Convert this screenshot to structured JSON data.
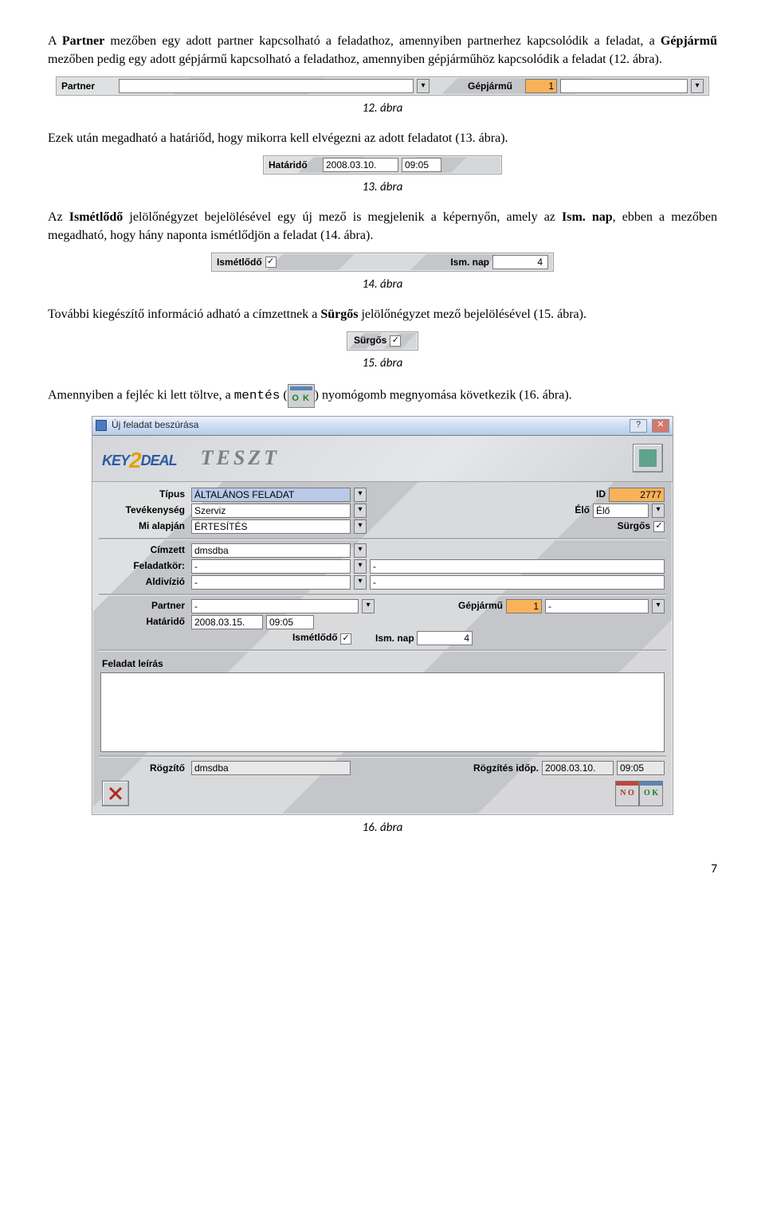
{
  "para1_pre": "A ",
  "para1_b1": "Partner",
  "para1_mid1": " mezőben egy adott partner kapcsolható a feladathoz, amennyiben partnerhez kapcsolódik a feladat, a ",
  "para1_b2": "Gépjármű",
  "para1_mid2": " mezőben pedig egy adott gépjármű kapcsolható a feladathoz, amennyiben gépjárműhöz kapcsolódik a feladat (12. ábra).",
  "fig12": {
    "partner_label": "Partner",
    "partner_value": "",
    "gepjarmu_label": "Gépjármű",
    "gepjarmu_code": "1",
    "gepjarmu_text": ""
  },
  "cap12": "12. ábra",
  "para2": "Ezek után megadható a határiőd, hogy mikorra kell elvégezni az adott feladatot (13. ábra).",
  "fig13": {
    "label": "Határidő",
    "date": "2008.03.10.",
    "time": "09:05"
  },
  "cap13": "13. ábra",
  "para3_pre": "Az ",
  "para3_b1": "Ismétlődő",
  "para3_mid": " jelölőnégyzet bejelölésével egy új mező is megjelenik a képernyőn, amely az ",
  "para3_b2": "Ism. nap",
  "para3_post": ", ebben a mezőben megadható, hogy hány naponta ismétlődjön a feladat (14. ábra).",
  "fig14": {
    "ism_label": "Ismétlődő",
    "ism_checked": "✓",
    "nap_label": "Ism. nap",
    "nap_value": "4"
  },
  "cap14": "14. ábra",
  "para4_pre": "További kiegészítő információ adható a címzettnek a ",
  "para4_b": "Sürgős",
  "para4_post": " jelölőnégyzet mező bejelölésével (15. ábra).",
  "fig15": {
    "label": "Sürgős",
    "checked": "✓"
  },
  "cap15": "15. ábra",
  "para5_pre": "Amennyiben a fejléc ki lett töltve, a ",
  "para5_mentes": "mentés",
  "para5_mid": " (",
  "okbtn_text": "O K",
  "para5_post": ") nyomógomb megnyomása következik (16. ábra).",
  "fig16": {
    "title": "Új feladat beszúrása",
    "logo": "KEY",
    "logo2": "DEAL",
    "brand": "TESZT",
    "labels": {
      "tipus": "Típus",
      "id": "ID",
      "tev": "Tevékenység",
      "elo": "Élő",
      "mial": "Mi alapján",
      "surgos": "Sürgős",
      "cimzett": "Címzett",
      "feladatkor": "Feladatkör:",
      "aldiv": "Aldivízió",
      "partner": "Partner",
      "gepjarmu": "Gépjármű",
      "hatarido": "Határidő",
      "ism": "Ismétlődő",
      "ismnap": "Ism. nap",
      "leiras": "Feladat leírás",
      "rogzito": "Rögzítő",
      "rogzidop": "Rögzítés időp."
    },
    "values": {
      "tipus": "ÁLTALÁNOS FELADAT",
      "id": "2777",
      "tev": "Szerviz",
      "elo": "Élő",
      "mial": "ÉRTESÍTÉS",
      "surgos_checked": "✓",
      "cimzett": "dmsdba",
      "feladatkor": "-",
      "feladatkor2": "-",
      "aldiv": "-",
      "aldiv2": "-",
      "partner": "-",
      "gj_code": "1",
      "gj_text": "-",
      "hat_date": "2008.03.15.",
      "hat_time": "09:05",
      "ism_checked": "✓",
      "ismnap": "4",
      "rogzito": "dmsdba",
      "rog_date": "2008.03.10.",
      "rog_time": "09:05"
    },
    "footer": {
      "no": "N O",
      "ok": "O K"
    }
  },
  "cap16": "16. ábra",
  "pagenum": "7"
}
